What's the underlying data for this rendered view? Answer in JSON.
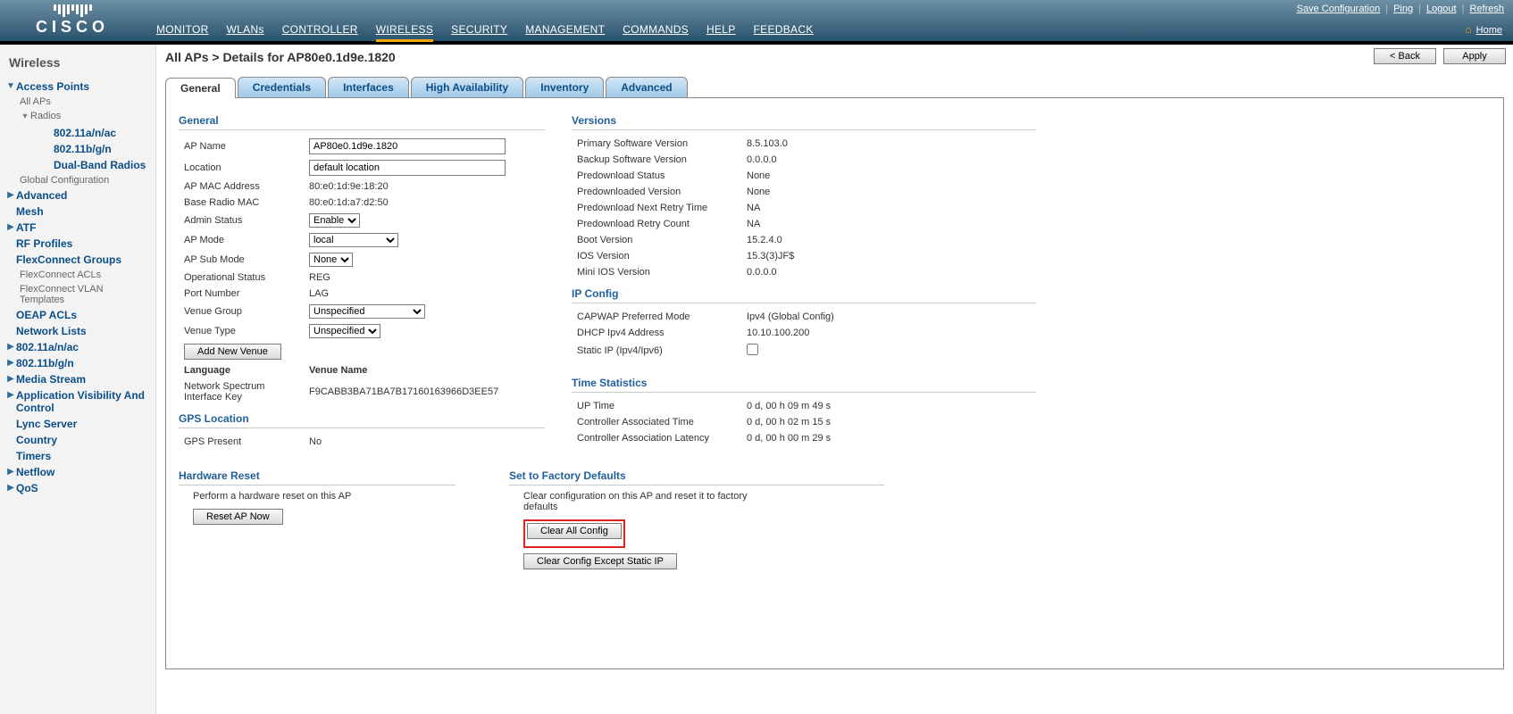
{
  "toputil": {
    "save": "Save Configuration",
    "ping": "Ping",
    "logout": "Logout",
    "refresh": "Refresh"
  },
  "home": "Home",
  "topnav": [
    "MONITOR",
    "WLANs",
    "CONTROLLER",
    "WIRELESS",
    "SECURITY",
    "MANAGEMENT",
    "COMMANDS",
    "HELP",
    "FEEDBACK"
  ],
  "sidebar": {
    "title": "Wireless",
    "ap": "Access Points",
    "allaps": "All APs",
    "radios": "Radios",
    "r1": "802.11a/n/ac",
    "r2": "802.11b/g/n",
    "r3": "Dual-Band Radios",
    "gc": "Global Configuration",
    "adv": "Advanced",
    "mesh": "Mesh",
    "atf": "ATF",
    "rf": "RF Profiles",
    "fcg": "FlexConnect Groups",
    "fca": "FlexConnect ACLs",
    "fcv": "FlexConnect VLAN Templates",
    "oeap": "OEAP ACLs",
    "nl": "Network Lists",
    "b1": "802.11a/n/ac",
    "b2": "802.11b/g/n",
    "ms": "Media Stream",
    "avc": "Application Visibility And Control",
    "lync": "Lync Server",
    "country": "Country",
    "timers": "Timers",
    "netflow": "Netflow",
    "qos": "QoS"
  },
  "page": {
    "title": "All APs > Details for AP80e0.1d9e.1820",
    "back": "< Back",
    "apply": "Apply"
  },
  "tabs": [
    "General",
    "Credentials",
    "Interfaces",
    "High Availability",
    "Inventory",
    "Advanced"
  ],
  "general": {
    "title": "General",
    "apname_lbl": "AP Name",
    "apname": "AP80e0.1d9e.1820",
    "loc_lbl": "Location",
    "loc": "default location",
    "mac_lbl": "AP MAC Address",
    "mac": "80:e0:1d:9e:18:20",
    "brm_lbl": "Base Radio MAC",
    "brm": "80:e0:1d:a7:d2:50",
    "admin_lbl": "Admin Status",
    "admin": "Enable",
    "mode_lbl": "AP Mode",
    "mode": "local",
    "sub_lbl": "AP Sub Mode",
    "sub": "None",
    "ops_lbl": "Operational Status",
    "ops": "REG",
    "port_lbl": "Port Number",
    "port": "LAG",
    "vg_lbl": "Venue Group",
    "vg": "Unspecified",
    "vt_lbl": "Venue Type",
    "vt": "Unspecified",
    "addvenue": "Add New Venue",
    "lang": "Language",
    "vname": "Venue Name",
    "nsk_lbl": "Network Spectrum Interface Key",
    "nsk": "F9CABB3BA71BA7B17160163966D3EE57",
    "gps_title": "GPS Location",
    "gps_lbl": "GPS Present",
    "gps": "No"
  },
  "versions": {
    "title": "Versions",
    "psv_lbl": "Primary Software Version",
    "psv": "8.5.103.0",
    "bsv_lbl": "Backup Software Version",
    "bsv": "0.0.0.0",
    "ps_lbl": "Predownload Status",
    "ps": "None",
    "pv_lbl": "Predownloaded Version",
    "pv": "None",
    "pnrt_lbl": "Predownload Next Retry Time",
    "pnrt": "NA",
    "prc_lbl": "Predownload Retry Count",
    "prc": "NA",
    "boot_lbl": "Boot Version",
    "boot": "15.2.4.0",
    "ios_lbl": "IOS Version",
    "ios": "15.3(3)JF$",
    "mios_lbl": "Mini IOS Version",
    "mios": "0.0.0.0"
  },
  "ip": {
    "title": "IP Config",
    "cpm_lbl": "CAPWAP Preferred Mode",
    "cpm": "Ipv4 (Global Config)",
    "dhcp_lbl": "DHCP Ipv4 Address",
    "dhcp": "10.10.100.200",
    "sip_lbl": "Static IP (Ipv4/Ipv6)"
  },
  "time": {
    "title": "Time Statistics",
    "up_lbl": "UP Time",
    "up": "0 d, 00 h 09 m 49 s",
    "cat_lbl": "Controller Associated Time",
    "cat": "0 d, 00 h 02 m 15 s",
    "cal_lbl": "Controller Association Latency",
    "cal": "0 d, 00 h 00 m 29 s"
  },
  "hw": {
    "title": "Hardware Reset",
    "desc": "Perform a hardware reset on this AP",
    "btn": "Reset AP Now"
  },
  "fd": {
    "title": "Set to Factory Defaults",
    "desc": "Clear configuration on this AP and reset it to factory defaults",
    "b1": "Clear All Config",
    "b2": "Clear Config Except Static IP"
  }
}
